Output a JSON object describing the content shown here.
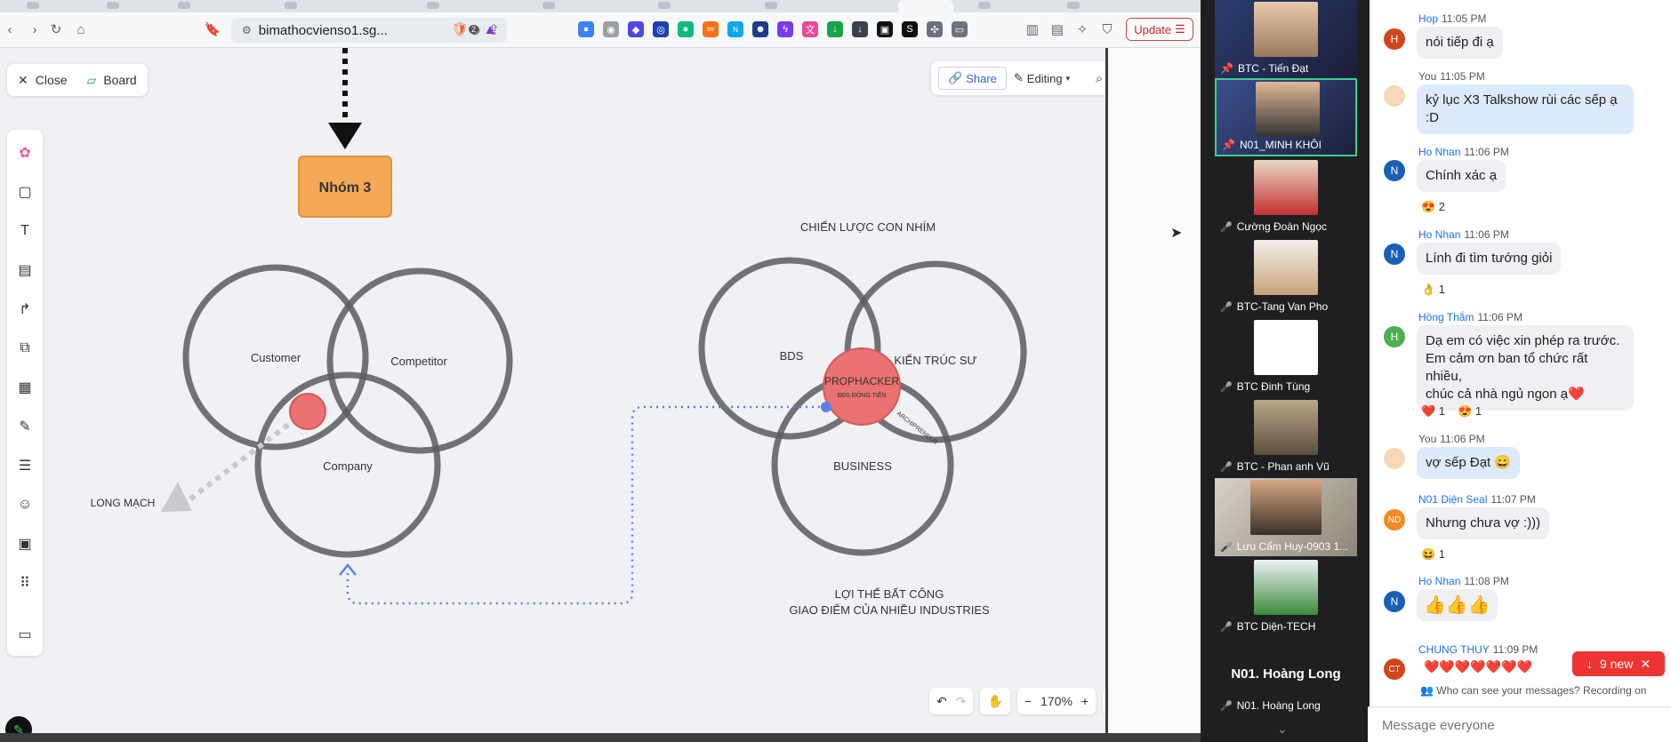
{
  "browser": {
    "url": "bimathocvienso1.sg...",
    "update_label": "Update",
    "notification_badge": "2"
  },
  "board": {
    "close_label": "Close",
    "board_label": "Board",
    "share_label": "Share",
    "editing_label": "Editing",
    "zoom_level": "170%",
    "group_box_label": "Nhóm 3",
    "left_diagram": {
      "circle_labels": [
        "Customer",
        "Competitor",
        "Company"
      ],
      "arrow_label": "LONG MẠCH"
    },
    "right_diagram": {
      "title": "CHIẾN LƯỢC CON NHÍM",
      "circle_labels": [
        "BDS",
        "KIẾN TRÚC SƯ",
        "BUSINESS"
      ],
      "center_title": "PROPHACKER",
      "center_subtitle": "BĐS ĐÔNG TIỀN",
      "curved_label": "ARCHIPRENEUR",
      "caption_line1": "LỢI THẾ BẤT CÔNG",
      "caption_line2": "GIAO ĐIỂM CỦA NHIỀU INDUSTRIES"
    },
    "colors": {
      "group_box": "#f5a855",
      "accent_red": "#ea7270",
      "dotted_blue": "#5b7fe8"
    }
  },
  "participants": [
    {
      "name": "BTC - Tiến Đạt",
      "pinned": true,
      "muted": false
    },
    {
      "name": "N01_MINH KHÔI",
      "pinned": true,
      "muted": false,
      "speaking": true
    },
    {
      "name": "Cường Đoàn Ngọc",
      "muted": true
    },
    {
      "name": "BTC-Tang Van Pho",
      "muted": true
    },
    {
      "name": "BTC Đinh Tùng",
      "muted": true
    },
    {
      "name": "BTC - Phan anh Vũ",
      "muted": true
    },
    {
      "name": "Lưu Cẩm Huy-0903 1...",
      "muted": true
    },
    {
      "name": "BTC Diện-TECH",
      "muted": true
    }
  ],
  "spotlight_name": "N01. Hoàng Long",
  "spotlight_tile_name": "N01. Hoàng Long",
  "chat": {
    "messages": [
      {
        "sender": "Hop",
        "time": "11:05 PM",
        "initial": "H",
        "color": "#d0451b",
        "text": "nói tiếp đi ạ",
        "mine": false
      },
      {
        "sender": "You",
        "time": "11:05 PM",
        "text_lines": [
          "kỷ lục X3 Talkshow rùi các sếp ạ",
          ":D"
        ],
        "mine": true
      },
      {
        "sender": "Ho Nhan",
        "time": "11:06 PM",
        "initial": "N",
        "color": "#1a5fb4",
        "text": "Chính xác ạ",
        "reaction": "😍 2"
      },
      {
        "sender": "Ho Nhan",
        "time": "11:06 PM",
        "initial": "N",
        "color": "#1a5fb4",
        "text": "Lính đi tìm tướng giỏi",
        "reaction": "👌 1"
      },
      {
        "sender": "Hồng Thắm",
        "time": "11:06 PM",
        "initial": "H",
        "color": "#4caf50",
        "text_lines": [
          "Dạ em có việc xin phép ra trước.",
          "Em cảm ơn ban tổ chức rất nhiều,",
          "chúc cả nhà ngủ ngon ạ❤️"
        ],
        "reaction_1": "❤️ 1",
        "reaction_2": "😍 1"
      },
      {
        "sender": "You",
        "time": "11:06 PM",
        "text": "vợ sếp Đạt 😄",
        "mine": true
      },
      {
        "sender": "N01 Diện Seal",
        "time": "11:07 PM",
        "initial": "ND",
        "color": "#f08a24",
        "text": "Nhưng chưa vợ :)))",
        "reaction": "😆 1"
      },
      {
        "sender": "Ho Nhan",
        "time": "11:08 PM",
        "initial": "N",
        "color": "#1a5fb4",
        "text": "👍👍👍"
      },
      {
        "sender": "CHUNG THUY",
        "time": "11:09 PM",
        "initial": "CT",
        "color": "#d0451b",
        "text": "❤️❤️❤️❤️❤️❤️❤️"
      }
    ],
    "new_count_label": "9 new",
    "notice": "Who can see your messages? Recording on",
    "input_placeholder": "Message everyone"
  }
}
